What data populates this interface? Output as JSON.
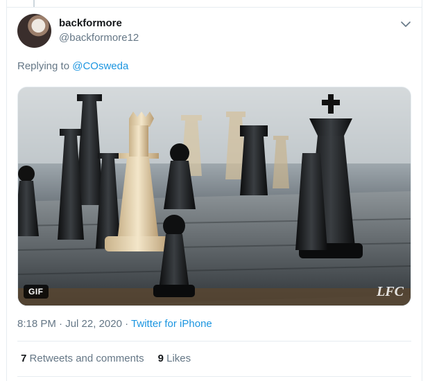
{
  "tweet": {
    "display_name": "backformore",
    "handle": "@backformore12",
    "replying_prefix": "Replying to",
    "replying_to": "@COsweda",
    "media": {
      "badge": "GIF",
      "watermark": "LFC",
      "icon": "chess-scene"
    },
    "time": "8:18 PM",
    "date": "Jul 22, 2020",
    "separator": "·",
    "source": "Twitter for iPhone",
    "retweets_count": "7",
    "retweets_label": "Retweets and comments",
    "likes_count": "9",
    "likes_label": "Likes"
  },
  "colors": {
    "link": "#1b95e0",
    "secondary_text": "#657786",
    "border": "#e6ecf0"
  }
}
